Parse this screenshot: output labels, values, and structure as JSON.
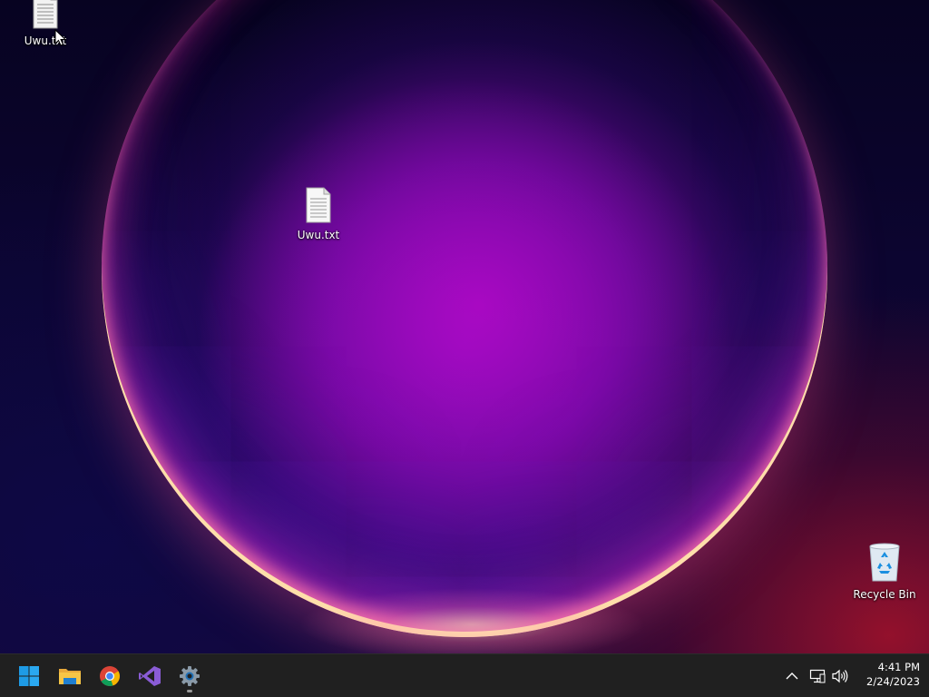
{
  "desktop": {
    "icons": [
      {
        "label": "Uwu.txt",
        "icon": "text-file-icon"
      },
      {
        "label": "Uwu.txt",
        "icon": "text-file-icon"
      },
      {
        "label": "Recycle Bin",
        "icon": "recycle-bin-icon"
      }
    ]
  },
  "taskbar": {
    "apps": [
      {
        "name": "start",
        "icon": "windows-logo-icon"
      },
      {
        "name": "file-explorer",
        "icon": "folder-icon"
      },
      {
        "name": "chrome",
        "icon": "chrome-icon"
      },
      {
        "name": "visual-studio",
        "icon": "visual-studio-icon"
      },
      {
        "name": "settings",
        "icon": "gear-icon",
        "running": true
      }
    ],
    "tray": {
      "icons": [
        "chevron-up-icon",
        "network-icon",
        "volume-icon"
      ],
      "time": "4:41 PM",
      "date": "2/24/2023"
    }
  },
  "colors": {
    "taskbar_bg": "#202020",
    "windows_blue": "#1e9be6",
    "vs_purple": "#8a5cd6"
  }
}
